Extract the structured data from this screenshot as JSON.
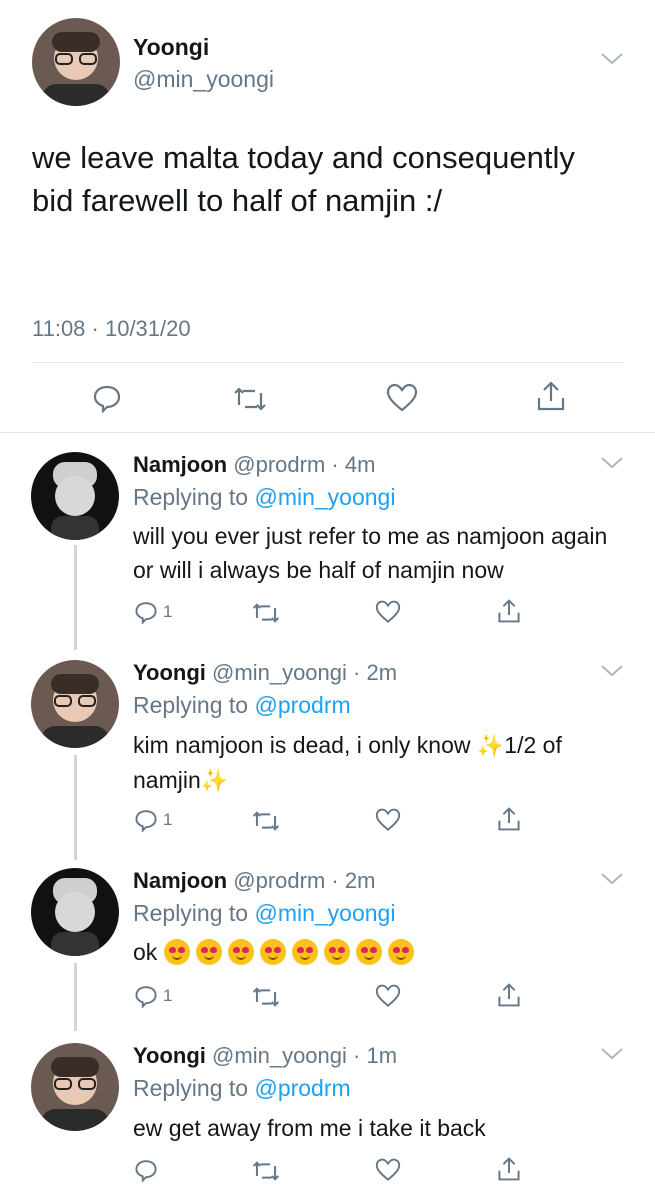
{
  "main_tweet": {
    "name": "Yoongi",
    "handle": "@min_yoongi",
    "text": "we leave malta today and consequently bid farewell to half of namjin :/",
    "timestamp": "11:08 · 10/31/20",
    "actions": [
      "reply-icon",
      "retweet-icon",
      "like-icon",
      "share-icon"
    ]
  },
  "replies": [
    {
      "name": "Namjoon",
      "handle": "@prodrm",
      "time": "4m",
      "replying_prefix": "Replying to ",
      "replying_to": "@min_yoongi",
      "text": "will you ever just refer to me as namjoon again or will i always be half of namjin now",
      "reply_count": "1"
    },
    {
      "name": "Yoongi",
      "handle": "@min_yoongi",
      "time": "2m",
      "replying_prefix": "Replying to ",
      "replying_to": "@prodrm",
      "text_a": "kim namjoon is dead, i only know",
      "sparkle": "✨",
      "text_b": "1/2 of namjin",
      "reply_count": "1"
    },
    {
      "name": "Namjoon",
      "handle": "@prodrm",
      "time": "2m",
      "replying_prefix": "Replying to ",
      "replying_to": "@min_yoongi",
      "text": "ok",
      "emojis": [
        "smiling-face-with-hearts",
        "smiling-face-with-hearts",
        "smiling-face-with-hearts",
        "smiling-face-with-hearts",
        "heart-eyes",
        "heart-eyes",
        "heart-eyes",
        "heart-eyes"
      ],
      "reply_count": "1"
    },
    {
      "name": "Yoongi",
      "handle": "@min_yoongi",
      "time": "1m",
      "replying_prefix": "Replying to ",
      "replying_to": "@prodrm",
      "text": "ew get away from me i take it back",
      "reply_count": ""
    }
  ],
  "colors": {
    "link": "#1da1f2",
    "muted": "#657786",
    "divider": "#e1e8ed"
  }
}
